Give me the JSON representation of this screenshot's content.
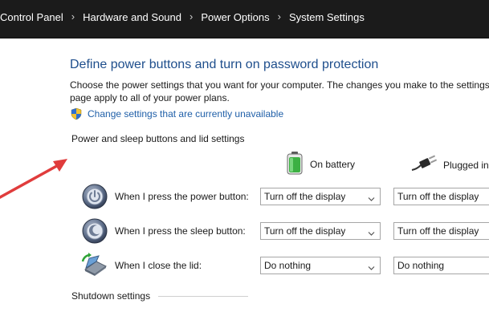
{
  "breadcrumb": {
    "items": [
      "Control Panel",
      "Hardware and Sound",
      "Power Options",
      "System Settings"
    ],
    "separator": "›"
  },
  "page": {
    "title": "Define power buttons and turn on password protection",
    "description": "Choose the power settings that you want for your computer. The changes you make to the settings page apply to all of your power plans.",
    "change_settings_link": "Change settings that are currently unavailable"
  },
  "sections": {
    "power_and_sleep": "Power and sleep buttons and lid settings",
    "shutdown": "Shutdown settings"
  },
  "columns": {
    "on_battery": "On battery",
    "plugged_in": "Plugged in"
  },
  "rows": [
    {
      "label": "When I press the power button:",
      "icon": "power-button-icon",
      "battery_value": "Turn off the display",
      "plugged_value": "Turn off the display"
    },
    {
      "label": "When I press the sleep button:",
      "icon": "sleep-button-icon",
      "battery_value": "Turn off the display",
      "plugged_value": "Turn off the display"
    },
    {
      "label": "When I close the lid:",
      "icon": "laptop-lid-icon",
      "battery_value": "Do nothing",
      "plugged_value": "Do nothing"
    }
  ],
  "colors": {
    "breadcrumb_bg": "#1b1b1b",
    "title": "#1e4e8c",
    "link": "#1f5fa8",
    "annotation_arrow": "#e03c3c"
  }
}
